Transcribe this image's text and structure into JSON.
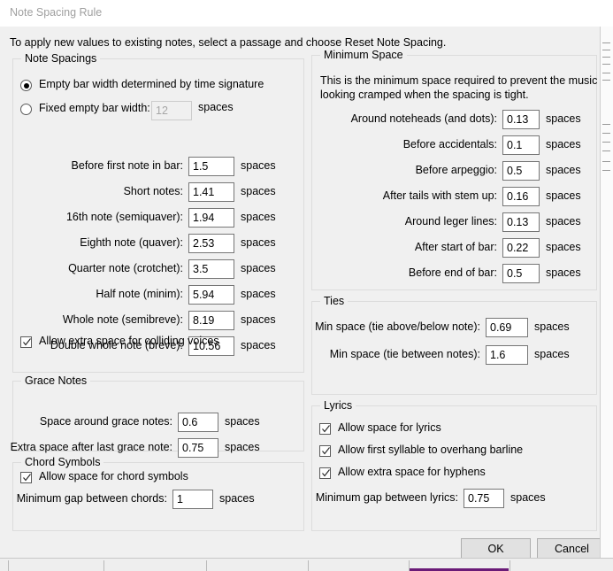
{
  "window": {
    "title": "Note Spacing Rule"
  },
  "intro": "To apply new values to existing notes, select a passage and choose Reset Note Spacing.",
  "units": {
    "spaces": "spaces"
  },
  "note_spacings": {
    "legend": "Note Spacings",
    "radio_time_signature": {
      "label": "Empty bar width determined by time signature",
      "checked": true
    },
    "radio_fixed": {
      "label": "Fixed empty bar width:",
      "checked": false,
      "value": "12",
      "enabled": false
    },
    "fields": [
      {
        "label": "Before first note in bar:",
        "value": "1.5"
      },
      {
        "label": "Short notes:",
        "value": "1.41"
      },
      {
        "label": "16th note (semiquaver):",
        "value": "1.94"
      },
      {
        "label": "Eighth note (quaver):",
        "value": "2.53"
      },
      {
        "label": "Quarter note (crotchet):",
        "value": "3.5"
      },
      {
        "label": "Half note (minim):",
        "value": "5.94"
      },
      {
        "label": "Whole note (semibreve):",
        "value": "8.19"
      },
      {
        "label": "Double whole note (breve):",
        "value": "10.56"
      }
    ],
    "checkbox_colliding": {
      "label": "Allow extra space for colliding voices",
      "checked": true
    }
  },
  "grace_notes": {
    "legend": "Grace Notes",
    "fields": [
      {
        "label": "Space around grace notes:",
        "value": "0.6"
      },
      {
        "label": "Extra space after last grace note:",
        "value": "0.75"
      }
    ]
  },
  "chord_symbols": {
    "legend": "Chord Symbols",
    "checkbox_allow": {
      "label": "Allow space for chord symbols",
      "checked": true
    },
    "fields": [
      {
        "label": "Minimum gap between chords:",
        "value": "1"
      }
    ]
  },
  "minimum_space": {
    "legend": "Minimum Space",
    "description_line1": "This is the minimum space required to prevent the music",
    "description_line2": "looking cramped when the spacing is tight.",
    "fields": [
      {
        "label": "Around noteheads (and dots):",
        "value": "0.13"
      },
      {
        "label": "Before accidentals:",
        "value": "0.1"
      },
      {
        "label": "Before arpeggio:",
        "value": "0.5"
      },
      {
        "label": "After tails with stem up:",
        "value": "0.16"
      },
      {
        "label": "Around leger lines:",
        "value": "0.13"
      },
      {
        "label": "After start of bar:",
        "value": "0.22"
      },
      {
        "label": "Before end of bar:",
        "value": "0.5"
      }
    ]
  },
  "ties": {
    "legend": "Ties",
    "fields": [
      {
        "label": "Min space (tie above/below note):",
        "value": "0.69"
      },
      {
        "label": "Min space (tie between notes):",
        "value": "1.6"
      }
    ]
  },
  "lyrics": {
    "legend": "Lyrics",
    "checkboxes": [
      {
        "label": "Allow space for lyrics",
        "checked": true
      },
      {
        "label": "Allow first syllable to overhang barline",
        "checked": true
      },
      {
        "label": "Allow extra space for hyphens",
        "checked": true
      }
    ],
    "fields": [
      {
        "label": "Minimum gap between lyrics:",
        "value": "0.75"
      }
    ]
  },
  "buttons": {
    "ok": "OK",
    "cancel": "Cancel"
  },
  "colors": {
    "dialog_background": "#f0f0f0",
    "titlebar_background": "#ffffff",
    "titlebar_text": "#a0a0a0",
    "group_border": "#dcdcdc",
    "field_border": "#767676",
    "field_border_disabled": "#cccccc",
    "button_face": "#e1e1e1",
    "button_border": "#adadad",
    "taskbar_accent": "#6a1b77"
  }
}
